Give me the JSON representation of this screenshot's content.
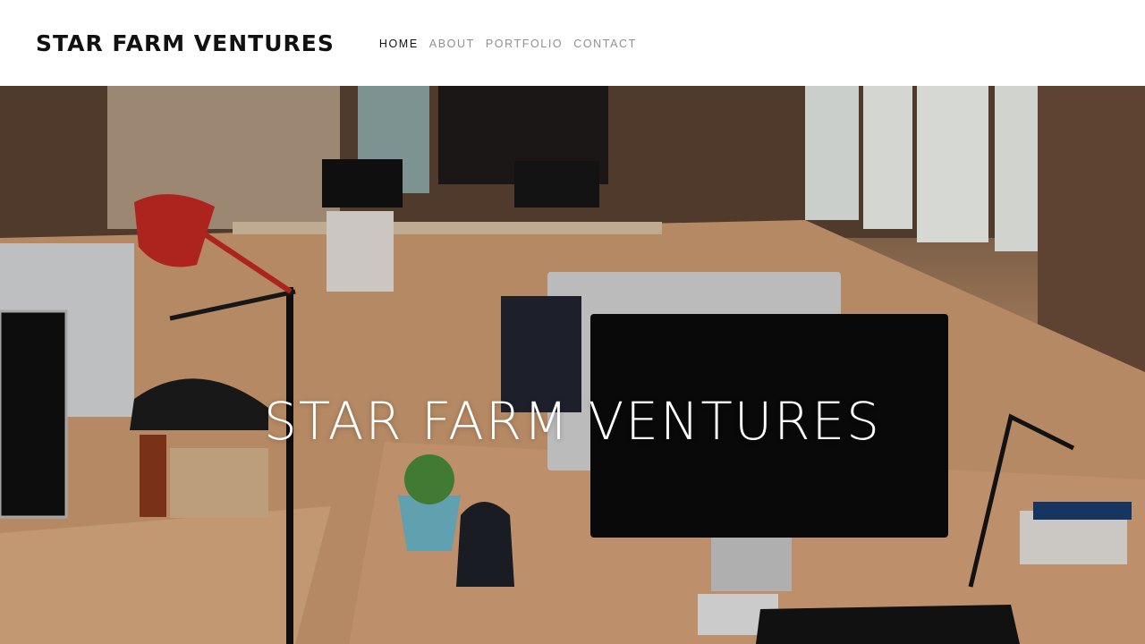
{
  "header": {
    "site_title": "STAR FARM VENTURES",
    "nav": [
      {
        "label": "HOME",
        "active": true
      },
      {
        "label": "ABOUT",
        "active": false
      },
      {
        "label": "PORTFOLIO",
        "active": false
      },
      {
        "label": "CONTACT",
        "active": false
      }
    ]
  },
  "hero": {
    "title": "STAR FARM VENTURES",
    "image": "office-workspace-photo"
  },
  "colors": {
    "title_text": "#111111",
    "nav_active": "#111111",
    "nav_inactive": "#8f8f8f",
    "hero_text": "#ffffff"
  }
}
